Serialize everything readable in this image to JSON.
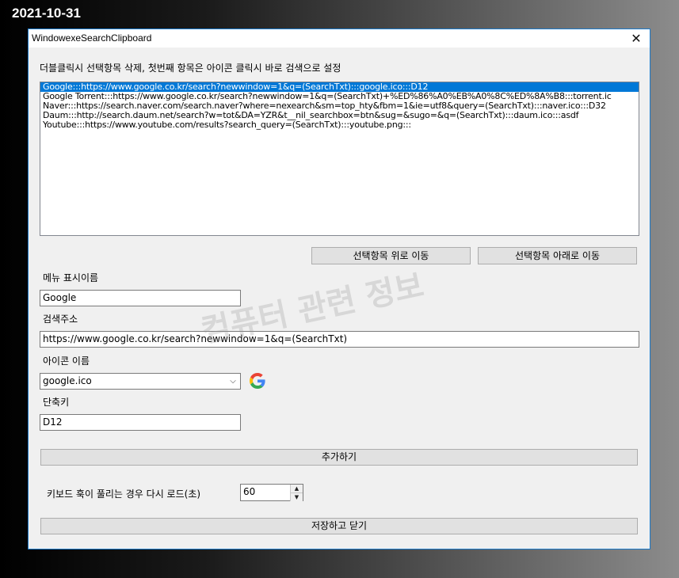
{
  "date_label": "2021-10-31",
  "window": {
    "title": "WindowexeSearchClipboard",
    "close_glyph": "✕"
  },
  "instruction": "더블클릭시 선택항목 삭제, 첫번째 항목은 아이콘 클릭시 바로 검색으로 설정",
  "list": {
    "items": [
      {
        "text": "Google:::https://www.google.co.kr/search?newwindow=1&q=(SearchTxt):::google.ico:::D12",
        "selected": true
      },
      {
        "text": "Google Torrent:::https://www.google.co.kr/search?newwindow=1&q=(SearchTxt)+%ED%86%A0%EB%A0%8C%ED%8A%B8:::torrent.ic",
        "selected": false
      },
      {
        "text": "Naver:::https://search.naver.com/search.naver?where=nexearch&sm=top_hty&fbm=1&ie=utf8&query=(SearchTxt):::naver.ico:::D32",
        "selected": false
      },
      {
        "text": "Daum:::http://search.daum.net/search?w=tot&DA=YZR&t__nil_searchbox=btn&sug=&sugo=&q=(SearchTxt):::daum.ico:::asdf",
        "selected": false
      },
      {
        "text": "Youtube:::https://www.youtube.com/results?search_query=(SearchTxt):::youtube.png:::",
        "selected": false
      }
    ]
  },
  "buttons": {
    "move_up": "선택항목 위로 이동",
    "move_down": "선택항목 아래로 이동",
    "add": "추가하기",
    "save_close": "저장하고 닫기"
  },
  "fields": {
    "menu_name_label": "메뉴 표시이름",
    "menu_name_value": "Google",
    "search_url_label": "검색주소",
    "search_url_value": "https://www.google.co.kr/search?newwindow=1&q=(SearchTxt)",
    "icon_name_label": "아이콘 이름",
    "icon_name_value": "google.ico",
    "hotkey_label": "단축키",
    "hotkey_value": "D12",
    "reload_label": "키보드 훅이 풀리는 경우 다시 로드(초)",
    "reload_value": "60"
  },
  "icon": {
    "name": "google-g-icon"
  },
  "watermark": "컴퓨터 관련 정보",
  "colors": {
    "accent": "#0078d7",
    "window_border": "#1979ca",
    "google_blue": "#4285F4",
    "google_red": "#EA4335",
    "google_yellow": "#FBBC05",
    "google_green": "#34A853"
  }
}
